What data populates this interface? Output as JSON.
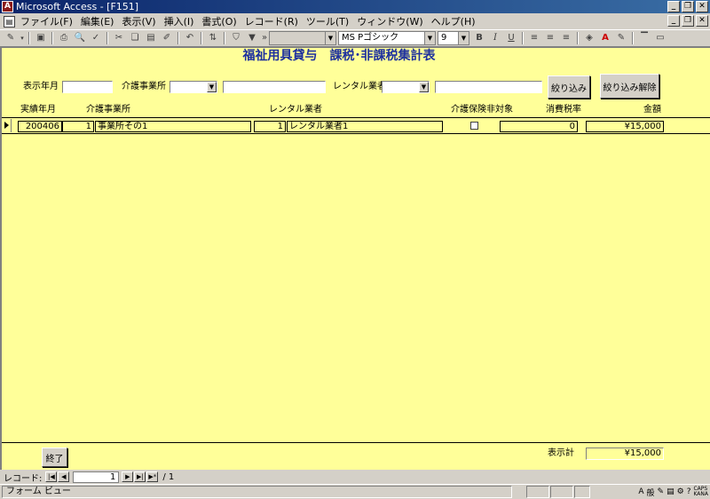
{
  "window": {
    "title": "Microsoft Access - [F151]"
  },
  "menu": [
    "ファイル(F)",
    "編集(E)",
    "表示(V)",
    "挿入(I)",
    "書式(O)",
    "レコード(R)",
    "ツール(T)",
    "ウィンドウ(W)",
    "ヘルプ(H)"
  ],
  "toolbar": {
    "font_name": "MS Pゴシック",
    "font_size": "9",
    "bold": "B",
    "italic": "I",
    "underline": "U",
    "expand": "»"
  },
  "form": {
    "title": "福祉用具貸与　課税･非課税集計表",
    "filters": {
      "display_month_label": "表示年月",
      "display_month_value": "",
      "care_office_label": "介護事業所",
      "care_office_value": "",
      "care_office_name": "",
      "rental_label": "レンタル業者",
      "rental_value": "",
      "rental_name": ""
    },
    "buttons": {
      "filter": "絞り込み",
      "clear_filter": "絞り込み解除",
      "close": "終了"
    },
    "columns": {
      "month": "実績年月",
      "office": "介護事業所",
      "rental": "レンタル業者",
      "nontax": "介護保険非対象",
      "tax_rate": "消費税率",
      "amount": "金額"
    },
    "row": {
      "month": "200406",
      "office_no": "1",
      "office_name": "事業所その1",
      "rental_no": "1",
      "rental_name": "レンタル業者1",
      "nontax_checked": false,
      "tax_rate": "0",
      "amount": "¥15,000"
    },
    "total_label": "表示計",
    "total_value": "¥15,000"
  },
  "navigation": {
    "label": "レコード:",
    "current": "1",
    "of_total": "/ 1"
  },
  "status": {
    "text": "フォーム ビュー",
    "ime": "般",
    "caps": "CAPS",
    "kana": "KANA"
  }
}
